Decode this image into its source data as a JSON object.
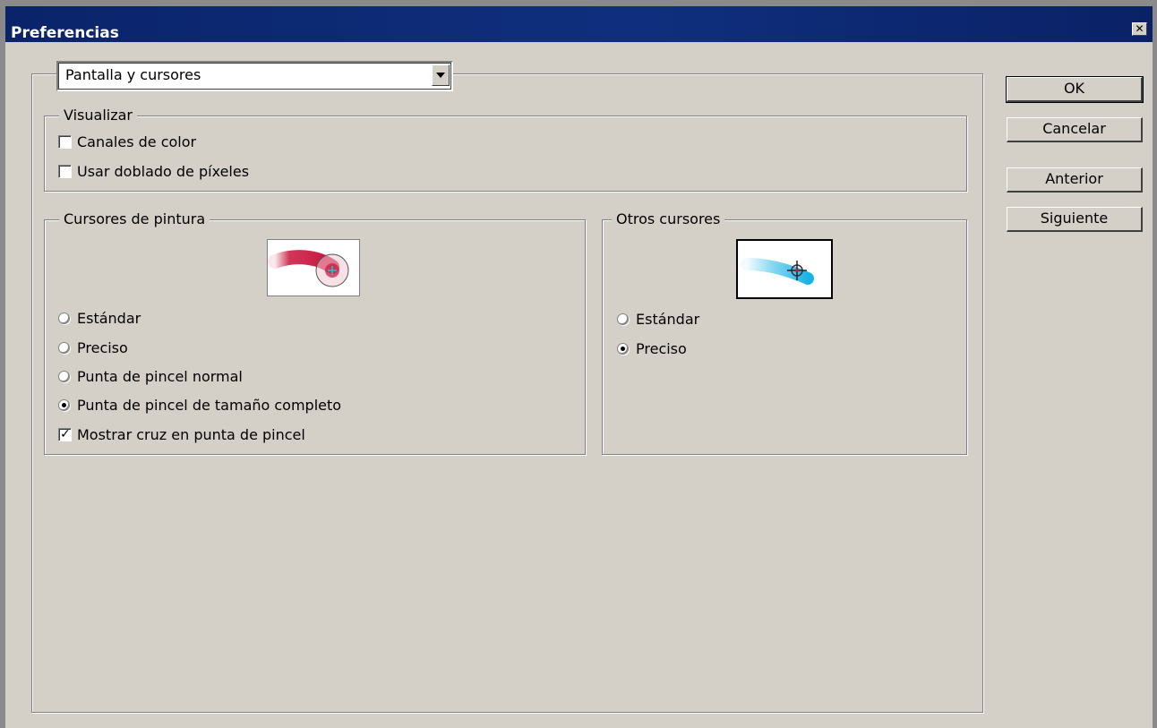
{
  "window": {
    "title": "Preferencias",
    "close_glyph": "✕"
  },
  "section_select": {
    "selected": "Pantalla y cursores"
  },
  "buttons": {
    "ok": "OK",
    "cancel": "Cancelar",
    "previous": "Anterior",
    "next": "Siguiente"
  },
  "display": {
    "legend": "Visualizar",
    "options": [
      {
        "label": "Canales de color",
        "checked": false
      },
      {
        "label": "Usar doblado de píxeles",
        "checked": false
      }
    ]
  },
  "painting_cursors": {
    "legend": "Cursores de pintura",
    "options": [
      {
        "label": "Estándar",
        "selected": false
      },
      {
        "label": "Preciso",
        "selected": false
      },
      {
        "label": "Punta de pincel normal",
        "selected": false
      },
      {
        "label": "Punta de pincel de tamaño completo",
        "selected": true
      }
    ],
    "crosshair": {
      "label": "Mostrar cruz en punta de pincel",
      "checked": true
    },
    "preview_icon": "paint-brush-stroke-preview",
    "stroke_color": "#c8143c"
  },
  "other_cursors": {
    "legend": "Otros cursores",
    "options": [
      {
        "label": "Estándar",
        "selected": false
      },
      {
        "label": "Preciso",
        "selected": true
      }
    ],
    "preview_icon": "precise-crosshair-preview",
    "stroke_color": "#19b4e6"
  },
  "colors": {
    "title_bar": "#0a246a",
    "face": "#d4d0c8"
  }
}
